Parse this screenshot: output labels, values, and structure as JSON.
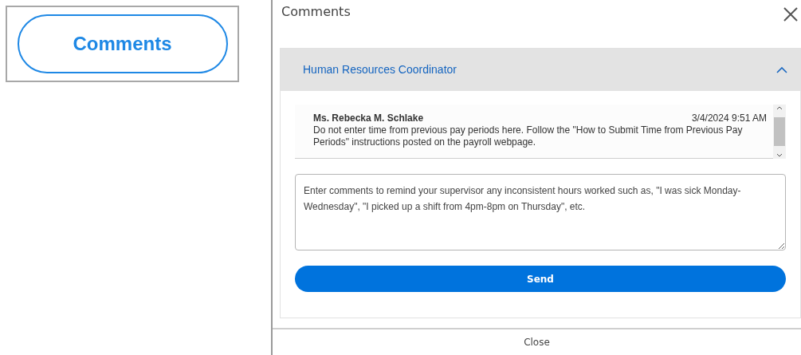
{
  "launcher": {
    "label": "Comments"
  },
  "dialog": {
    "title": "Comments",
    "section": {
      "title": "Human Resources Coordinator",
      "expanded": true,
      "comments": [
        {
          "author": "Ms. Rebecka M. Schlake",
          "time": "3/4/2024 9:51 AM",
          "text": "Do not enter time from previous pay periods here. Follow the \"How to Submit Time from Previous Pay Periods\" instructions posted on the payroll webpage."
        }
      ],
      "input": {
        "placeholder": "Enter comments to remind your supervisor any inconsistent hours worked such as, \"I was sick Monday-Wednesday\", \"I picked up a shift from 4pm-8pm on Thursday\", etc."
      },
      "send": "Send"
    },
    "footer_button": "Close"
  }
}
